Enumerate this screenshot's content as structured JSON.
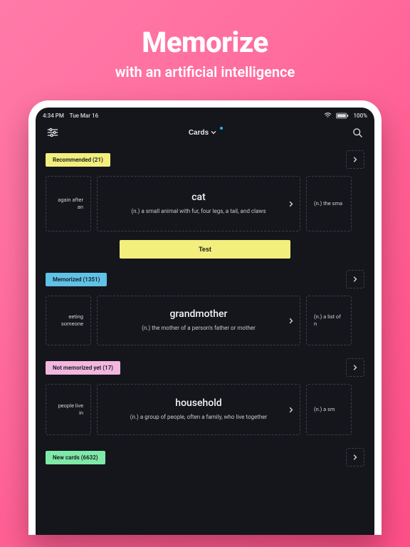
{
  "hero": {
    "title": "Memorize",
    "subtitle": "with an artificial intelligence"
  },
  "statusbar": {
    "time": "4:34 PM",
    "date": "Tue Mar 16",
    "battery": "100%"
  },
  "nav": {
    "title": "Cards"
  },
  "sections": {
    "recommended": {
      "label": "Recommended (21)",
      "peek_left": "again after an",
      "peek_right": "(n.) the sma",
      "card": {
        "title": "cat",
        "definition": "(n.) a small animal with fur, four legs, a tail, and claws"
      },
      "test_label": "Test"
    },
    "memorized": {
      "label": "Memorized (1351)",
      "peek_left": "eeting someone",
      "peek_right": "(n.) a list of n",
      "card": {
        "title": "grandmother",
        "definition": "(n.) the mother of a person's father or mother"
      }
    },
    "not_memorized": {
      "label": "Not memorized yet (17)",
      "peek_left": "people live in",
      "peek_right": "(n.) a sm",
      "card": {
        "title": "household",
        "definition": "(n.) a group of people, often a family, who live together"
      }
    },
    "new_cards": {
      "label": "New cards (6632)"
    }
  }
}
